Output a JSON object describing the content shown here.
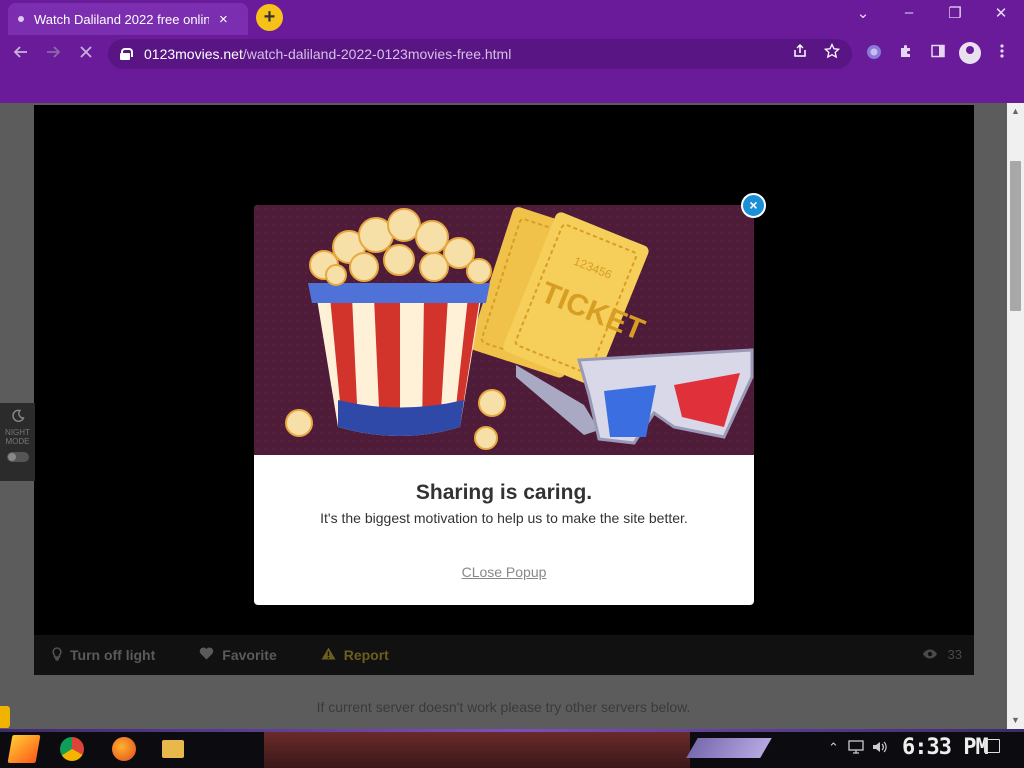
{
  "browser": {
    "tab_title": "Watch Daliland 2022 free onlin",
    "tab_close": "×",
    "new_tab": "+",
    "url_domain": "0123movies.net",
    "url_path": "/watch-daliland-2022-0123movies-free.html",
    "win_minimize": "–",
    "win_restore": "❐",
    "win_close": "✕",
    "win_menu": "⌄"
  },
  "page": {
    "night_mode_label": "NIGHT MODE",
    "player_bar": {
      "turn_off_light": "Turn off light",
      "favorite": "Favorite",
      "report": "Report",
      "views": "33"
    },
    "server_note": "If current server doesn't work please try other servers below."
  },
  "modal": {
    "title": "Sharing is caring.",
    "subtitle": "It's the biggest motivation to help us to make the site better.",
    "close_link": "CLose Popup",
    "close_x": "×",
    "art": {
      "ticket_text": "TICKET",
      "ticket_number": "123456"
    }
  },
  "taskbar": {
    "clock": "6:33 PM"
  },
  "colors": {
    "chrome_purple": "#6a1b9a",
    "modal_art_bg": "#4e1c38",
    "close_blue": "#1a8fd6",
    "new_tab_yellow": "#f6c21a"
  },
  "icons": {
    "back": "arrow-left-icon",
    "forward": "arrow-right-icon",
    "stop": "close-icon",
    "share": "share-icon",
    "bookmark": "star-icon",
    "extensions": "puzzle-icon",
    "sidepanel": "sidepanel-icon",
    "profile": "profile-icon",
    "menu": "kebab-menu-icon",
    "lightbulb": "lightbulb-icon",
    "heart": "heart-icon",
    "warning": "warning-icon",
    "eye": "eye-icon",
    "moon": "moon-icon"
  }
}
